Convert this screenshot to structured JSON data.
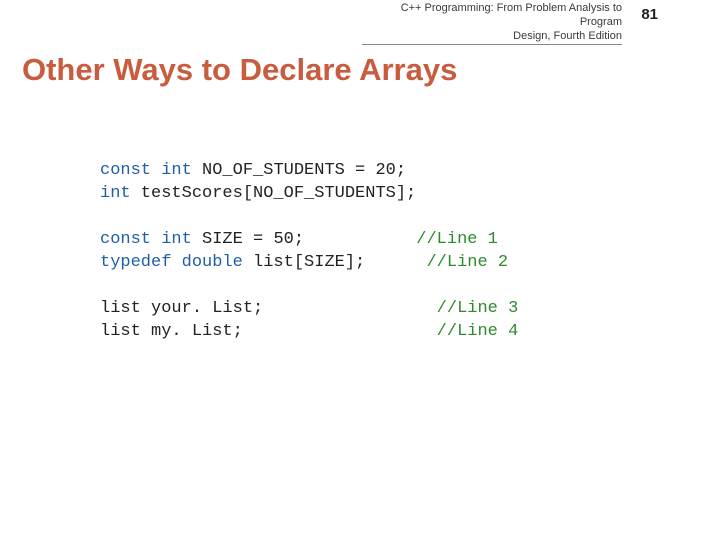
{
  "header": {
    "book_title_line1": "C++ Programming: From Problem Analysis to Program",
    "book_title_line2": "Design, Fourth Edition",
    "page_number": "81"
  },
  "title": "Other Ways to Declare Arrays",
  "code": {
    "l1_kw": "const int",
    "l1_rest": " NO_OF_STUDENTS = 20;",
    "l2_kw": "int",
    "l2_rest": " testScores[NO_OF_STUDENTS];",
    "l3_kw": "const int",
    "l3_rest": " SIZE = 50;",
    "l3_cmt": "//Line 1",
    "l4_kw": "typedef double",
    "l4_rest": " list[SIZE];",
    "l4_cmt": "//Line 2",
    "l5": "list your. List;",
    "l5_cmt": "//Line 3",
    "l6": "list my. List;",
    "l6_cmt": "//Line 4"
  }
}
